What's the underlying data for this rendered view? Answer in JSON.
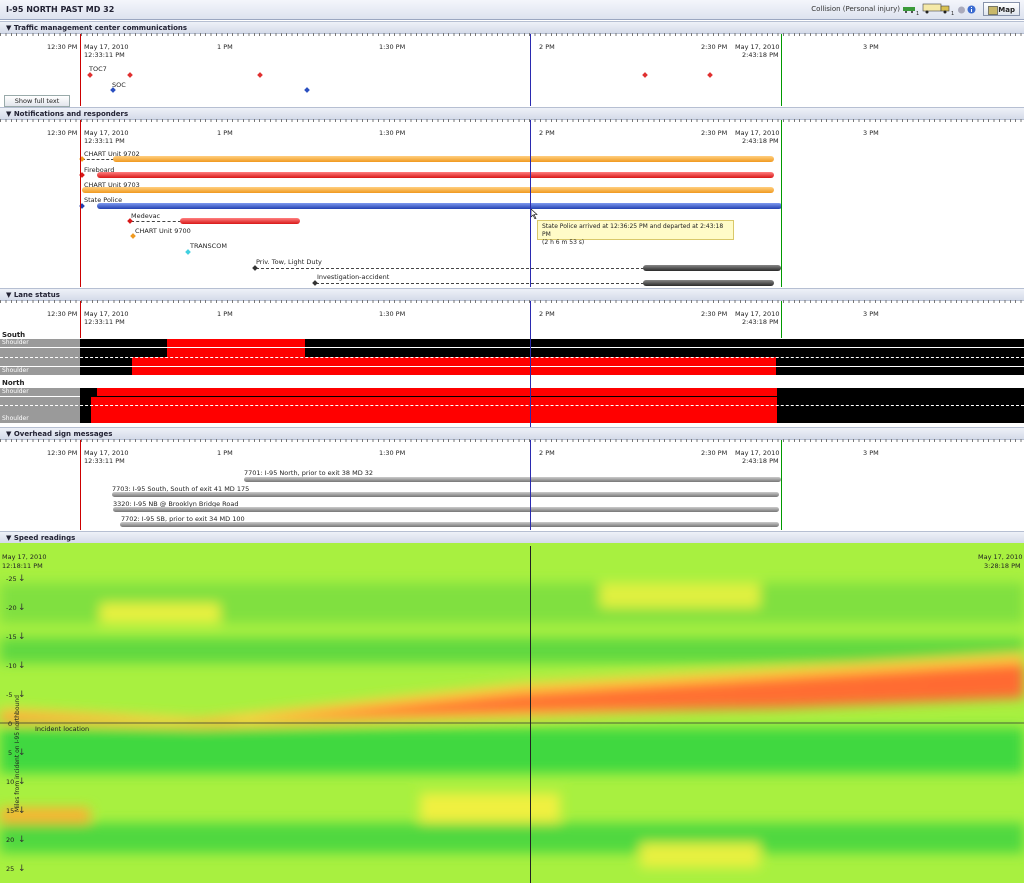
{
  "window": {
    "title": "I-95 NORTH PAST MD 32",
    "incident_type": "Collision (Personal injury)",
    "vehicle_counts": [
      "1",
      "1"
    ],
    "map_label": "Map"
  },
  "time_axis": {
    "start_date": "May 17, 2010",
    "start_time": "12:33:11 PM",
    "end_date": "May 17, 2010",
    "end_time": "2:43:18 PM",
    "ticks": [
      "12:30 PM",
      "1 PM",
      "1:30 PM",
      "2 PM",
      "2:30 PM",
      "3 PM"
    ]
  },
  "sections": {
    "tmc": {
      "title": "Traffic management center communications",
      "show_full_text": "Show full text",
      "labels": [
        "TOC7",
        "SOC"
      ]
    },
    "notifications": {
      "title": "Notifications and responders",
      "responders": [
        "CHART Unit 9702",
        "Fireboard",
        "CHART Unit 9703",
        "State Police",
        "Medevac",
        "CHART Unit 9700",
        "TRANSCOM",
        "Priv. Tow, Light Duty",
        "Investigation-accident"
      ],
      "tooltip_line1": "State Police arrived at 12:36:25 PM and departed at 2:43:18 PM",
      "tooltip_line2": "(2 h 6 m 53 s)"
    },
    "lanes": {
      "title": "Lane status",
      "south": "South",
      "north": "North",
      "shoulder": "Shoulder"
    },
    "signs": {
      "title": "Overhead sign messages",
      "messages": [
        "7701: I-95 North, prior to exit 38 MD 32",
        "7703: I-95 South, South of exit 41 MD 175",
        "3320: I-95 NB @ Brooklyn Bridge Road",
        "7702: I-95 SB, prior to exit 34 MD 100"
      ]
    },
    "speed": {
      "title": "Speed readings",
      "start_date": "May 17, 2010",
      "start_time": "12:18:11 PM",
      "end_date": "May 17, 2010",
      "end_time": "3:28:18 PM",
      "y_ticks": [
        "-25",
        "-20",
        "-15",
        "-10",
        "-5",
        "0",
        "5",
        "10",
        "15",
        "20",
        "25"
      ],
      "y_label": "Miles from incident on I-95 northbound",
      "incident_label": "Incident location"
    }
  },
  "colors": {
    "incident_start": "#cc0000",
    "incident_end": "#009900",
    "cursor": "#2a2ab0",
    "orange": "#f0a030",
    "red": "#e02020",
    "blue": "#2a4fc0",
    "dark": "#2a2a2a"
  }
}
